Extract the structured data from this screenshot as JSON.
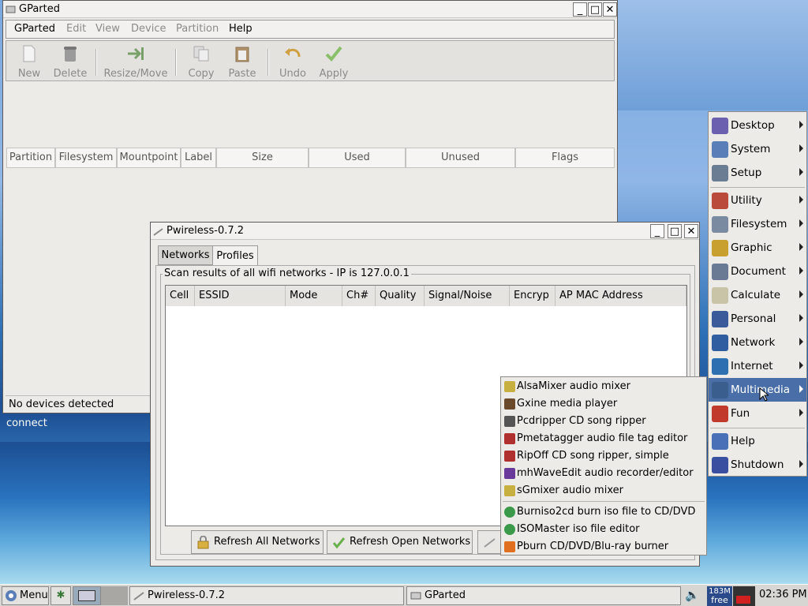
{
  "gparted": {
    "title": "GParted",
    "menu": [
      "GParted",
      "Edit",
      "View",
      "Device",
      "Partition",
      "Help"
    ],
    "toolbar": [
      "New",
      "Delete",
      "Resize/Move",
      "Copy",
      "Paste",
      "Undo",
      "Apply"
    ],
    "columns": [
      "Partition",
      "Filesystem",
      "Mountpoint",
      "Label",
      "Size",
      "Used",
      "Unused",
      "Flags"
    ],
    "status": "No devices detected"
  },
  "pwireless": {
    "title": "Pwireless-0.7.2",
    "tabs": [
      "Networks",
      "Profiles"
    ],
    "frame_label": "Scan results of all wifi networks -  IP is 127.0.0.1",
    "columns": [
      "Cell",
      "ESSID",
      "Mode",
      "Ch#",
      "Quality",
      "Signal/Noise",
      "Encryp",
      "AP MAC Address"
    ],
    "buttons": [
      "Refresh All Networks",
      "Refresh Open Networks"
    ]
  },
  "desktop": {
    "connect_label": "connect"
  },
  "main_menu": {
    "items": [
      {
        "label": "Desktop",
        "icon": "desktop-icon",
        "color": "#6b5fb0",
        "submenu": true
      },
      {
        "label": "System",
        "icon": "system-icon",
        "color": "#5a7fb8",
        "submenu": true
      },
      {
        "label": "Setup",
        "icon": "setup-icon",
        "color": "#6b7d92",
        "submenu": true
      },
      {
        "label": "Utility",
        "icon": "utility-icon",
        "color": "#b94a3c",
        "submenu": true
      },
      {
        "label": "Filesystem",
        "icon": "filesystem-icon",
        "color": "#7a8aa0",
        "submenu": true
      },
      {
        "label": "Graphic",
        "icon": "graphic-icon",
        "color": "#c8a030",
        "submenu": true
      },
      {
        "label": "Document",
        "icon": "document-icon",
        "color": "#6a7a95",
        "submenu": true
      },
      {
        "label": "Calculate",
        "icon": "calculate-icon",
        "color": "#c9c3a8",
        "submenu": true
      },
      {
        "label": "Personal",
        "icon": "personal-icon",
        "color": "#3a5a9a",
        "submenu": true
      },
      {
        "label": "Network",
        "icon": "network-icon",
        "color": "#2f5da0",
        "submenu": true
      },
      {
        "label": "Internet",
        "icon": "internet-icon",
        "color": "#2d6fb0",
        "submenu": true
      },
      {
        "label": "Multimedia",
        "icon": "multimedia-icon",
        "color": "#3a5f8f",
        "submenu": true
      },
      {
        "label": "Fun",
        "icon": "fun-icon",
        "color": "#c0392b",
        "submenu": true
      },
      {
        "label": "Help",
        "icon": "help-icon",
        "color": "#4a70b8",
        "submenu": false
      },
      {
        "label": "Shutdown",
        "icon": "shutdown-icon",
        "color": "#3a4fa0",
        "submenu": true
      }
    ]
  },
  "multimedia_menu": {
    "items": [
      {
        "label": "AlsaMixer audio mixer",
        "icon": "speaker-icon"
      },
      {
        "label": "Gxine media player",
        "icon": "film-icon"
      },
      {
        "label": "Pcdripper CD song ripper",
        "icon": "ripper-icon"
      },
      {
        "label": "Pmetatagger audio file tag editor",
        "icon": "tag-icon"
      },
      {
        "label": "RipOff CD song ripper, simple",
        "icon": "ripoff-icon"
      },
      {
        "label": "mhWaveEdit audio recorder/editor",
        "icon": "wave-icon"
      },
      {
        "label": "sGmixer audio mixer",
        "icon": "speaker-icon"
      },
      {
        "label": "Burniso2cd burn iso file to CD/DVD",
        "icon": "disc-icon"
      },
      {
        "label": "ISOMaster iso file editor",
        "icon": "disc-icon"
      },
      {
        "label": "Pburn CD/DVD/Blu-ray burner",
        "icon": "flame-icon"
      }
    ]
  },
  "taskbar": {
    "menu_label": "Menu",
    "tasks": [
      "Pwireless-0.7.2",
      "GParted"
    ],
    "mem_top": "183M",
    "mem_bottom": "free",
    "clock": "02:36 PM"
  }
}
